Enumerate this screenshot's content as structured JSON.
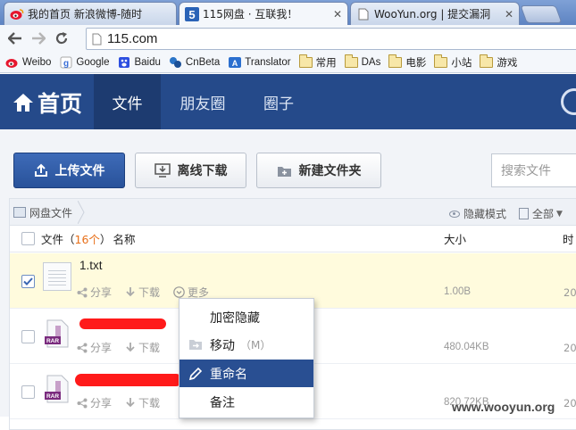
{
  "browser": {
    "tabs": [
      {
        "title": "我的首页 新浪微博-随时",
        "icon": "weibo-icon"
      },
      {
        "title": "115网盘 · 互联我！",
        "icon": "115-icon",
        "active": true
      },
      {
        "title": "WooYun.org | 提交漏洞",
        "icon": "page-icon"
      }
    ],
    "url": "115.com",
    "bookmarks": [
      {
        "label": "Weibo",
        "icon": "weibo-icon"
      },
      {
        "label": "Google",
        "icon": "google-icon"
      },
      {
        "label": "Baidu",
        "icon": "baidu-icon"
      },
      {
        "label": "CnBeta",
        "icon": "cnbeta-icon"
      },
      {
        "label": "Translator",
        "icon": "translator-icon"
      },
      {
        "label": "常用",
        "icon": "folder-icon"
      },
      {
        "label": "DAs",
        "icon": "folder-icon"
      },
      {
        "label": "电影",
        "icon": "folder-icon"
      },
      {
        "label": "小站",
        "icon": "folder-icon"
      },
      {
        "label": "游戏",
        "icon": "folder-icon"
      }
    ]
  },
  "header": {
    "home": "首页",
    "tabs": [
      "文件",
      "朋友圈",
      "圈子"
    ]
  },
  "actions": {
    "upload": "上传文件",
    "offline": "离线下载",
    "new_folder": "新建文件夹",
    "search_placeholder": "搜索文件"
  },
  "crumbs": {
    "root": "网盘文件",
    "hidden_mode": "隐藏模式",
    "filter": "全部"
  },
  "columns": {
    "files_prefix": "文件（",
    "files_count": "16个",
    "files_suffix": "）",
    "name": "名称",
    "size": "大小",
    "time": "时"
  },
  "row_actions": {
    "share": "分享",
    "download": "下载",
    "more": "更多"
  },
  "files": [
    {
      "name": "1.txt",
      "size": "1.00B",
      "time": "20",
      "selected": true
    },
    {
      "name": "",
      "size": "480.04KB",
      "time": "20"
    },
    {
      "name": "",
      "size": "820.72KB",
      "time": "20"
    }
  ],
  "context_menu": [
    {
      "label": "加密隐藏"
    },
    {
      "label": "移动",
      "hint": "（M）"
    },
    {
      "label": "重命名",
      "highlighted": true
    },
    {
      "label": "备注"
    }
  ],
  "watermark": "www.wooyun.org",
  "colors": {
    "header": "#254a8a",
    "primary": "#29529a",
    "selected_row": "#fffbdd",
    "redaction": "#ff1a1a"
  }
}
